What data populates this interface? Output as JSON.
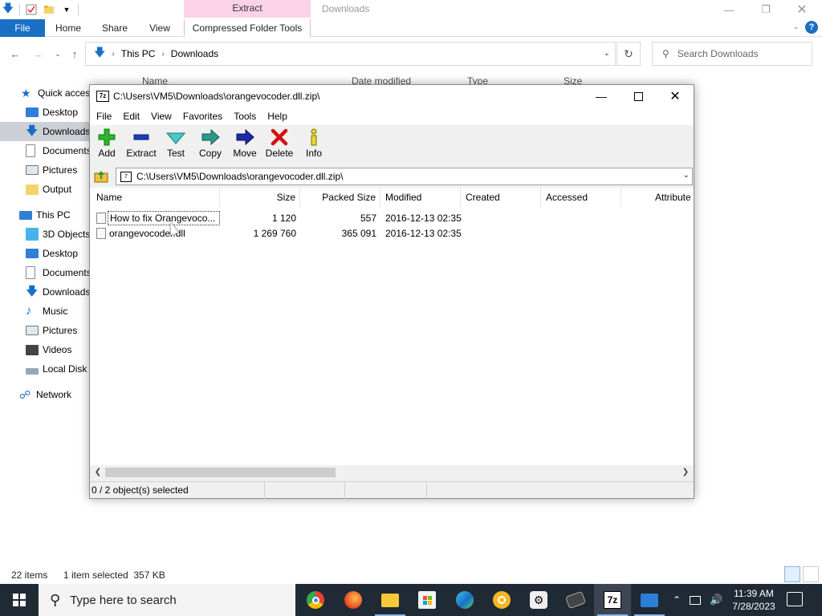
{
  "explorer": {
    "title": "Downloads",
    "context_tab_header": "Extract",
    "ribbon_tabs": [
      "File",
      "Home",
      "Share",
      "View",
      "Compressed Folder Tools"
    ],
    "breadcrumb": [
      "This PC",
      "Downloads"
    ],
    "search_placeholder": "Search Downloads",
    "columns": [
      "Name",
      "Date modified",
      "Type",
      "Size"
    ],
    "nav": {
      "quick_access": "Quick access",
      "quick_items": [
        "Desktop",
        "Downloads",
        "Documents",
        "Pictures",
        "Output"
      ],
      "this_pc": "This PC",
      "pc_items": [
        "3D Objects",
        "Desktop",
        "Documents",
        "Downloads",
        "Music",
        "Pictures",
        "Videos",
        "Local Disk ("
      ],
      "network": "Network"
    },
    "status": {
      "items": "22 items",
      "selected": "1 item selected  357 KB"
    }
  },
  "sevenzip": {
    "title": "C:\\Users\\VM5\\Downloads\\orangevocoder.dll.zip\\",
    "logo_text": "7z",
    "menu": [
      "File",
      "Edit",
      "View",
      "Favorites",
      "Tools",
      "Help"
    ],
    "toolbar": [
      "Add",
      "Extract",
      "Test",
      "Copy",
      "Move",
      "Delete",
      "Info"
    ],
    "path": "C:\\Users\\VM5\\Downloads\\orangevocoder.dll.zip\\",
    "columns": [
      "Name",
      "Size",
      "Packed Size",
      "Modified",
      "Created",
      "Accessed",
      "Attribute"
    ],
    "rows": [
      {
        "name": "How to fix Orangevoco...",
        "size": "1 120",
        "packed": "557",
        "modified": "2016-12-13 02:35"
      },
      {
        "name": "orangevocoder.dll",
        "size": "1 269 760",
        "packed": "365 091",
        "modified": "2016-12-13 02:35"
      }
    ],
    "status": "0 / 2 object(s) selected"
  },
  "taskbar": {
    "search_placeholder": "Type here to search",
    "time": "11:39 AM",
    "date": "7/28/2023",
    "active_app_label": "7z"
  },
  "colors": {
    "accent": "#1a6fc5",
    "context_tab": "#fbd2e6",
    "taskbar": "#1f2a34",
    "selection": "#ccd0d6"
  }
}
